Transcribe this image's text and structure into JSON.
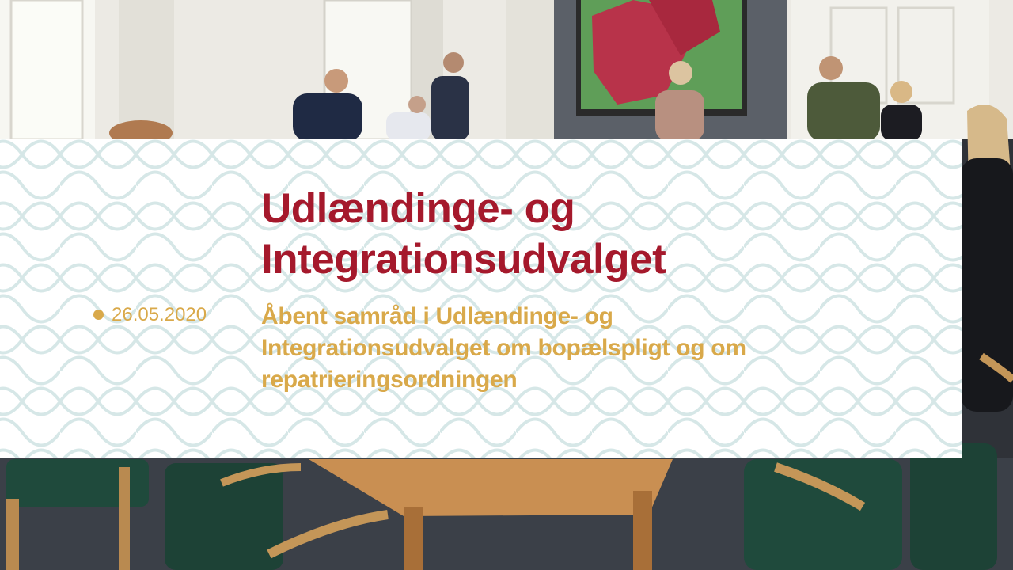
{
  "banner": {
    "title_line1": "Udlændinge- og",
    "title_line2": "Integrationsudvalget",
    "date": "26.05.2020",
    "description_line1": "Åbent samråd i Udlændinge- og",
    "description_line2": "Integrationsudvalget om bopælspligt og om",
    "description_line3": "repatrieringsordningen"
  },
  "colors": {
    "title": "#a5192c",
    "accent_gold": "#d9a94a",
    "pattern": "#cfe3e3",
    "banner_background": "#ffffff"
  }
}
